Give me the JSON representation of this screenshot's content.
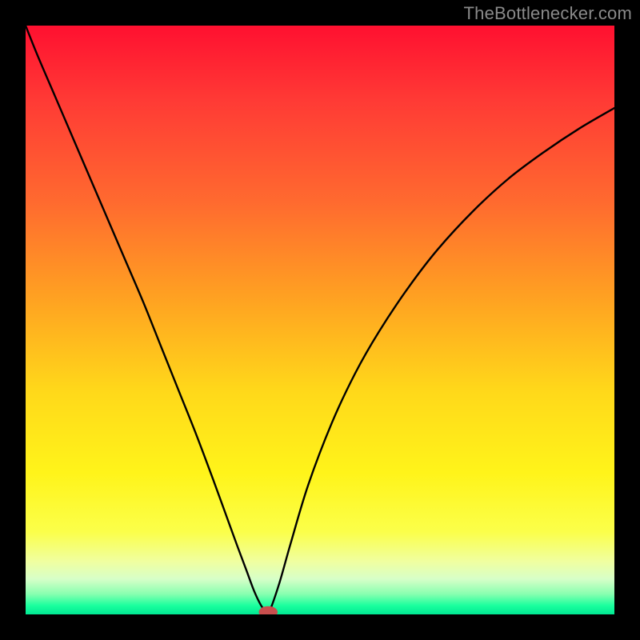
{
  "attribution": "TheBottlenecker.com",
  "colors": {
    "frame": "#000000",
    "curve": "#000000",
    "marker": "#c94f4e",
    "gradient_stops": [
      {
        "offset": 0.0,
        "color": "#ff1030"
      },
      {
        "offset": 0.13,
        "color": "#ff3b35"
      },
      {
        "offset": 0.3,
        "color": "#ff6a2f"
      },
      {
        "offset": 0.47,
        "color": "#ffa421"
      },
      {
        "offset": 0.62,
        "color": "#ffd81a"
      },
      {
        "offset": 0.76,
        "color": "#fff41a"
      },
      {
        "offset": 0.86,
        "color": "#fbff4a"
      },
      {
        "offset": 0.91,
        "color": "#f0ffa0"
      },
      {
        "offset": 0.94,
        "color": "#d7ffc8"
      },
      {
        "offset": 0.965,
        "color": "#8affb0"
      },
      {
        "offset": 0.985,
        "color": "#1aff9e"
      },
      {
        "offset": 1.0,
        "color": "#00e893"
      }
    ]
  },
  "chart_data": {
    "type": "line",
    "title": "",
    "xlabel": "",
    "ylabel": "",
    "xlim": [
      0,
      100
    ],
    "ylim": [
      0,
      100
    ],
    "series": [
      {
        "name": "bottleneck-curve",
        "x": [
          0,
          2,
          5,
          8,
          11,
          14,
          17,
          20,
          23,
          26,
          29,
          32,
          34,
          36,
          37.5,
          38.8,
          40,
          40.8,
          41.2,
          43,
          45,
          48,
          52,
          56,
          60,
          65,
          70,
          76,
          82,
          88,
          94,
          100
        ],
        "y": [
          100,
          95,
          88,
          81,
          74,
          67,
          60,
          53,
          45.5,
          38,
          30.5,
          22.5,
          17,
          11.5,
          7.5,
          4,
          1.5,
          0.5,
          0,
          5,
          12,
          22,
          32.5,
          41,
          48,
          55.5,
          62,
          68.5,
          74,
          78.5,
          82.5,
          86
        ]
      }
    ],
    "marker": {
      "x": 41.2,
      "y": 0.4,
      "rx": 1.6,
      "ry": 1.0
    },
    "annotations": []
  }
}
